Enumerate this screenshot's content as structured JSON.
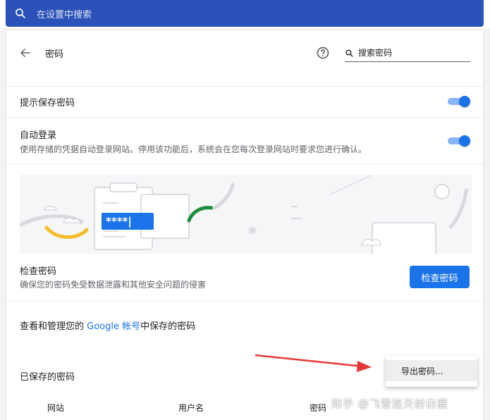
{
  "settings_search": {
    "placeholder": "在设置中搜索"
  },
  "header": {
    "title": "密码",
    "search_placeholder": "搜索密码"
  },
  "offer_to_save": {
    "label": "提示保存密码",
    "enabled": true
  },
  "auto_signin": {
    "label": "自动登录",
    "description": "使用存储的凭据自动登录网站。停用该功能后，系统会在您每次登录网站时要求您进行确认。",
    "enabled": true
  },
  "illustration": {
    "password_mask": "****|"
  },
  "check_passwords": {
    "label": "检查密码",
    "description": "确保您的密码免受数据泄露和其他安全问题的侵害",
    "button": "检查密码"
  },
  "google_account": {
    "prefix": "查看和管理您的 ",
    "link": "Google 帐号",
    "suffix": "中保存的密码"
  },
  "saved_passwords": {
    "label": "已保存的密码"
  },
  "menu": {
    "export_label": "导出密码..."
  },
  "columns": {
    "site": "网站",
    "username": "用户名",
    "password": "密码"
  },
  "watermark": "知乎 @飞雪连天射白鹿",
  "colors": {
    "accent": "#1a73e8",
    "search_bar": "#2b52b8",
    "annotation_arrow": "#e53935"
  }
}
